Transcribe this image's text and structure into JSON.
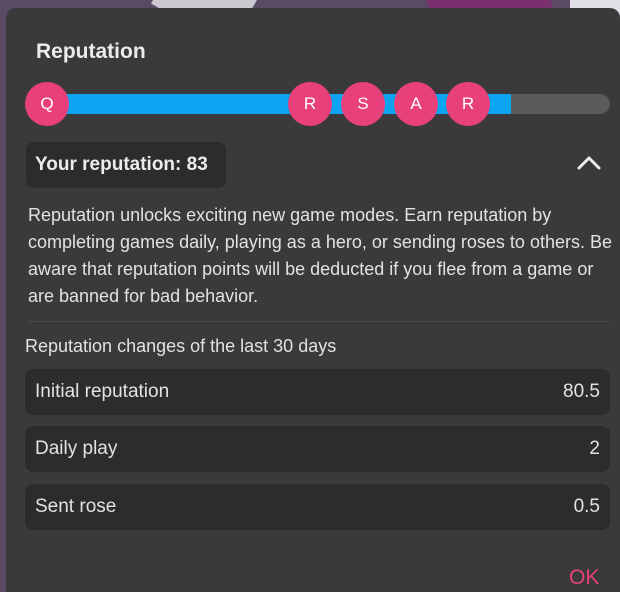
{
  "dialog": {
    "title": "Reputation",
    "ok_label": "OK"
  },
  "reputation_bar": {
    "fill_fraction": 0.83,
    "markers": [
      "Q",
      "R",
      "S",
      "A",
      "R"
    ],
    "fill_color": "#0aa4f0",
    "marker_color": "#e8407a"
  },
  "badge": {
    "text": "Your reputation: 83"
  },
  "description": "Reputation unlocks exciting new game modes. Earn reputation by completing games daily, playing as a hero, or sending roses to others. Be aware that reputation points will be deducted if you flee from a game or are banned for bad behavior.",
  "changes": {
    "heading": "Reputation changes of the last 30 days",
    "rows": [
      {
        "label": "Initial reputation",
        "value": "80.5"
      },
      {
        "label": "Daily play",
        "value": "2"
      },
      {
        "label": "Sent rose",
        "value": "0.5"
      }
    ]
  },
  "icons": {
    "collapse": "chevron-up-icon"
  }
}
